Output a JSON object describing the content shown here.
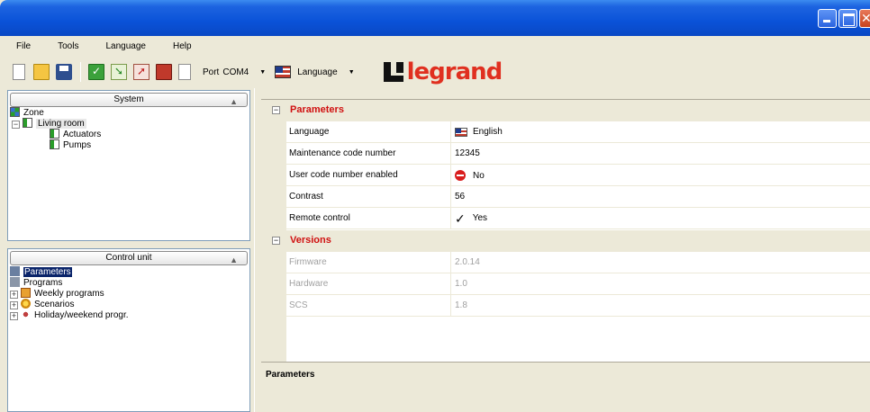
{
  "menu": [
    "File",
    "Tools",
    "Language",
    "Help"
  ],
  "toolbar": {
    "port_label": "Port",
    "port_value": "COM4",
    "language_label": "Language",
    "logo_text": "legrand",
    "icons": [
      "new-icon",
      "open-folder-icon",
      "save-icon",
      "check-icon",
      "receive-icon",
      "send-icon",
      "erase-icon",
      "document-icon"
    ]
  },
  "system_pane": {
    "header": "System",
    "tree": {
      "root": "Zone",
      "room": "Living room",
      "children": [
        "Actuators",
        "Pumps"
      ]
    }
  },
  "control_pane": {
    "header": "Control unit",
    "items": [
      "Parameters",
      "Programs",
      "Weekly programs",
      "Scenarios",
      "Holiday/weekend progr."
    ]
  },
  "properties": {
    "sections": [
      {
        "title": "Parameters",
        "rows": [
          {
            "name": "Language",
            "value": "English"
          },
          {
            "name": "Maintenance code number",
            "value": "12345"
          },
          {
            "name": "User code number enabled",
            "value": "No"
          },
          {
            "name": "Contrast",
            "value": "56"
          },
          {
            "name": "Remote control",
            "value": "Yes"
          }
        ]
      },
      {
        "title": "Versions",
        "rows": [
          {
            "name": "Firmware",
            "value": "2.0.14"
          },
          {
            "name": "Hardware",
            "value": "1.0"
          },
          {
            "name": "SCS",
            "value": "1.8"
          }
        ]
      }
    ]
  },
  "help": {
    "title": "Parameters"
  }
}
